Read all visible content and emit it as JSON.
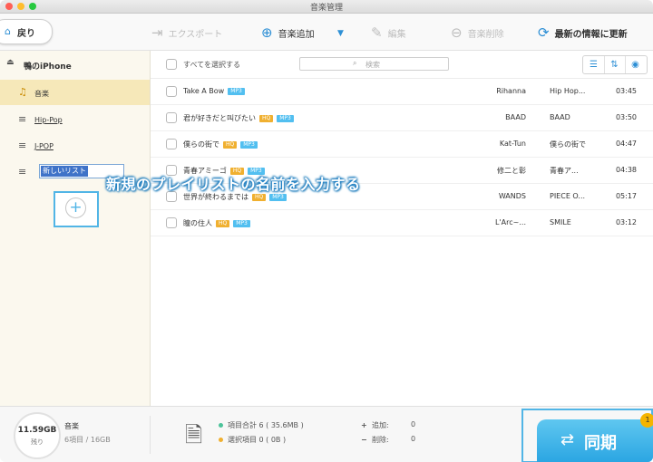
{
  "window": {
    "title": "音楽管理"
  },
  "toolbar": {
    "back_label": "戻り",
    "export_label": "エクスポート",
    "add_music_label": "音楽追加",
    "edit_label": "編集",
    "delete_label": "音楽削除",
    "refresh_label": "最新の情報に更新"
  },
  "sidebar": {
    "device_name": "鴨のiPhone",
    "items": [
      {
        "label": "音楽",
        "icon": "headphones-icon",
        "selected": true
      },
      {
        "label": "Hip-Pop",
        "icon": "playlist-icon"
      },
      {
        "label": "J-POP",
        "icon": "playlist-icon"
      }
    ],
    "new_playlist_value": "新しいリスト"
  },
  "list": {
    "select_all_label": "すべてを選択する",
    "search_placeholder": "検索",
    "view_icons": [
      "list-view-icon",
      "sort-icon",
      "itunes-icon"
    ],
    "rows": [
      {
        "title": "Take A Bow",
        "badges": [
          "MP3"
        ],
        "artist": "Rihanna",
        "album": "Hip Hop...",
        "time": "03:45"
      },
      {
        "title": "君が好きだと叫びたい",
        "badges": [
          "HQ",
          "MP3"
        ],
        "artist": "BAAD",
        "album": "BAAD",
        "time": "03:50"
      },
      {
        "title": "僕らの街で",
        "badges": [
          "HQ",
          "MP3"
        ],
        "artist": "Kat-Tun",
        "album": "僕らの街で",
        "time": "04:47"
      },
      {
        "title": "青春アミーゴ",
        "badges": [
          "HQ",
          "MP3"
        ],
        "artist": "修二と彰",
        "album": "青春ア...",
        "time": "04:38"
      },
      {
        "title": "世界が終わるまでは",
        "badges": [
          "HQ",
          "MP3"
        ],
        "artist": "WANDS",
        "album": "PIECE O...",
        "time": "05:17"
      },
      {
        "title": "瞳の住人",
        "badges": [
          "HQ",
          "MP3"
        ],
        "artist": "L'Arc~...",
        "album": "SMILE",
        "time": "03:12"
      }
    ]
  },
  "annotation": {
    "text": "新規のプレイリストの名前を入力する"
  },
  "bottom": {
    "storage_value": "11.59GB",
    "storage_sub": "残り",
    "category": "音楽",
    "category_count": "6項目 / 16GB",
    "summary_total": "項目合計 6 ( 35.6MB )",
    "summary_selected": "選択項目 0 ( 0B )",
    "add_label": "追加:",
    "add_value": "0",
    "del_label": "削除:",
    "del_value": "0",
    "sync_label": "同期",
    "sync_badge": "1"
  },
  "colors": {
    "accent": "#2d8fd5",
    "mp3_badge": "#52bff0",
    "hq_badge": "#f0b030",
    "sidebar_selected": "#f6e8b9"
  }
}
